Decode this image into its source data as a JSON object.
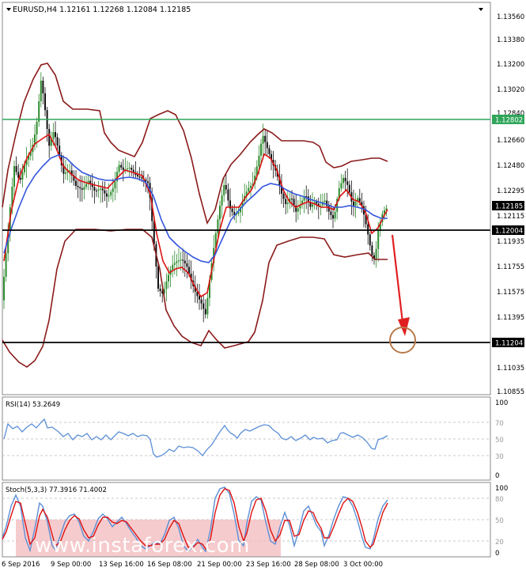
{
  "header": {
    "symbol_info": "EURUSD,H4  1.12161 1.12268 1.12084 1.12185"
  },
  "main_panel": {
    "price_axis_labels": [
      "1.13560",
      "1.13380",
      "1.13200",
      "1.13020",
      "1.12840",
      "1.12660",
      "1.12480",
      "1.12295",
      "1.12115",
      "1.11935",
      "1.11755",
      "1.11575",
      "1.11395",
      "1.11035",
      "1.10855"
    ],
    "badges": {
      "resistance": "1.12802",
      "current_price": "1.12185",
      "support_1": "1.12004",
      "support_2": "1.11204"
    },
    "colors": {
      "resistance_line": "#2fa55a",
      "level_line": "#000000",
      "bollinger": "#8b1a1a",
      "ma_fast": "#dd1111",
      "ma_slow": "#3355dd",
      "candle_up": "#2e8b2e",
      "candle_down": "#111111",
      "forecast_arrow": "#e02020",
      "target_circle": "#b87a4a"
    }
  },
  "rsi_panel": {
    "label": "RSI(14) 53.2649",
    "axis_labels": [
      "100",
      "70",
      "50",
      "30",
      "0"
    ]
  },
  "stoch_panel": {
    "label": "Stoch(5,3,3) 77.3916 71.4002",
    "axis_labels": [
      "100",
      "80",
      "50",
      "20",
      "0"
    ]
  },
  "time_axis_labels": [
    "6 Sep 2016",
    "9 Sep 00:00",
    "13 Sep 16:00",
    "16 Sep 08:00",
    "21 Sep 00:00",
    "23 Sep 16:00",
    "28 Sep 08:00",
    "3 Oct 00:00"
  ],
  "watermark": "www.instaforex.com",
  "icons": {
    "dropdown_indicator": "triangle-down-icon",
    "dropdown_indicator_alt": "triangle-down-icon"
  }
}
